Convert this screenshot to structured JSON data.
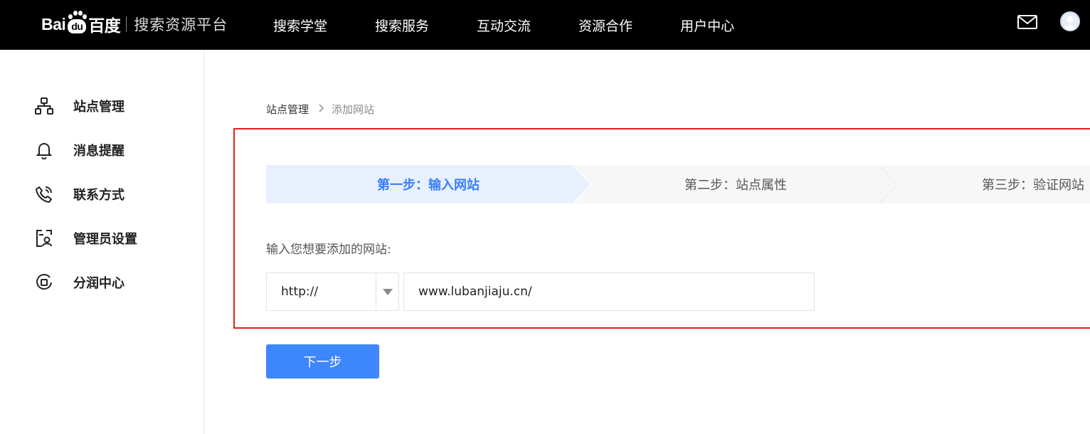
{
  "header": {
    "logo_left": "Bai",
    "logo_paw": "du",
    "logo_right": "百度",
    "platform_name": "搜索资源平台",
    "nav": [
      {
        "label": "搜索学堂"
      },
      {
        "label": "搜索服务"
      },
      {
        "label": "互动交流"
      },
      {
        "label": "资源合作"
      },
      {
        "label": "用户中心"
      }
    ],
    "icons": {
      "mail": "mail-icon",
      "avatar": "user-avatar-icon"
    }
  },
  "sidebar": {
    "items": [
      {
        "label": "站点管理",
        "icon": "sitemap-icon"
      },
      {
        "label": "消息提醒",
        "icon": "bell-icon"
      },
      {
        "label": "联系方式",
        "icon": "phone-icon"
      },
      {
        "label": "管理员设置",
        "icon": "admin-icon"
      },
      {
        "label": "分润中心",
        "icon": "revenue-icon"
      }
    ]
  },
  "breadcrumb": {
    "parent": "站点管理",
    "current": "添加网站"
  },
  "steps": [
    {
      "label": "第一步：输入网站",
      "active": true
    },
    {
      "label": "第二步：站点属性",
      "active": false
    },
    {
      "label": "第三步：验证网站",
      "active": false
    }
  ],
  "form": {
    "label": "输入您想要添加的网站:",
    "protocol": "http://",
    "url_value": "www.lubanjiaju.cn/"
  },
  "next_button": "下一步",
  "colors": {
    "accent": "#3e86fb",
    "active_step_bg": "#e8f0fe",
    "highlight_border": "#e02020",
    "topbar_bg": "#000000"
  }
}
